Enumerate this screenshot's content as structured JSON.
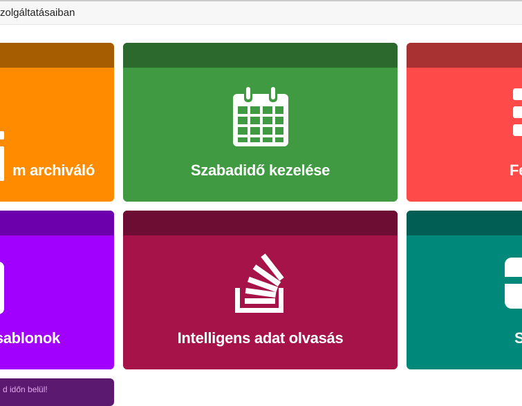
{
  "header": {
    "title_fragment": "zolgáltatásaiban"
  },
  "colors": {
    "orange": "#ff8c00",
    "orange_header": "#a65c00",
    "green": "#3f9a41",
    "green_header": "#2b6a2c",
    "red": "#ff4a4a",
    "red_header": "#a83232",
    "purple": "#a100ff",
    "purple_header": "#6c00ad",
    "crimson": "#a51348",
    "crimson_header": "#6e0d33",
    "teal": "#00897b",
    "teal_header": "#005e54",
    "footer": "#5b1a6f"
  },
  "tiles": [
    {
      "label": "m archiváló",
      "icon": "archive-icon"
    },
    {
      "label": "Szabadidő kezelése",
      "icon": "calendar-icon"
    },
    {
      "label": "Fe",
      "icon": "list-icon"
    },
    {
      "label": "sablonok",
      "icon": "template-icon"
    },
    {
      "label": "Intelligens adat olvasás",
      "icon": "stack-icon"
    },
    {
      "label": "S",
      "icon": "box-icon"
    }
  ],
  "footer": {
    "text": "d időn belül!"
  }
}
